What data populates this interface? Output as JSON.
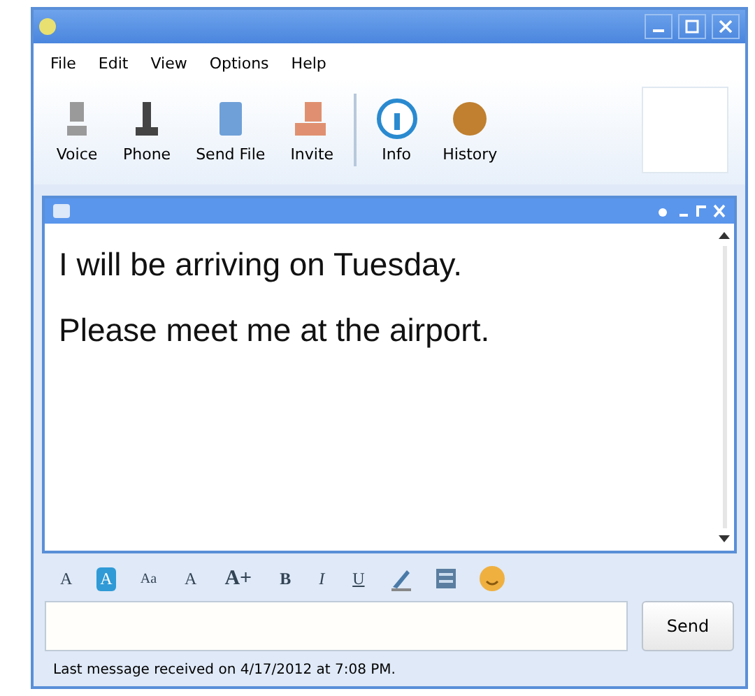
{
  "menu": [
    "File",
    "Edit",
    "View",
    "Options",
    "Help"
  ],
  "toolbar": [
    {
      "label": "Voice",
      "kind": "mic"
    },
    {
      "label": "Phone",
      "kind": "phone"
    },
    {
      "label": "Send File",
      "kind": "file"
    },
    {
      "label": "Invite",
      "kind": "invite"
    },
    {
      "label": "Info",
      "kind": "info"
    },
    {
      "label": "History",
      "kind": "history"
    }
  ],
  "messages": [
    "I will be arriving on Tuesday.",
    "Please meet me at the airport."
  ],
  "format_tools": [
    {
      "label": "A",
      "kind": "font",
      "selected": false
    },
    {
      "label": "A",
      "kind": "color",
      "selected": true
    },
    {
      "label": "Aa",
      "kind": "small",
      "selected": false
    },
    {
      "label": "A",
      "kind": "plain",
      "selected": false
    },
    {
      "label": "A+",
      "kind": "big",
      "selected": false
    },
    {
      "label": "B",
      "kind": "bold",
      "selected": false
    },
    {
      "label": "I",
      "kind": "italic",
      "selected": false
    },
    {
      "label": "U",
      "kind": "under",
      "selected": false
    }
  ],
  "send_button": "Send",
  "status_bar": "Last message received on 4/17/2012 at 7:08 PM."
}
